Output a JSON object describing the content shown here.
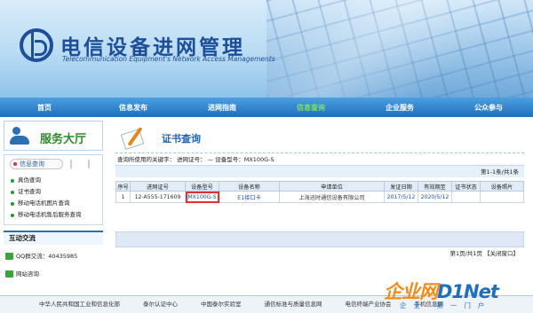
{
  "header": {
    "title_cn": "电信设备进网管理",
    "title_en": "Telecommunication Equipment's Network Access Managements"
  },
  "nav": {
    "items": [
      "首页",
      "信息发布",
      "进网指南",
      "信息查询",
      "企业服务",
      "公众参与"
    ],
    "active": "信息查询"
  },
  "sidebar": {
    "hall_title": "服务大厅",
    "query_tab": "信息查询",
    "query_items": [
      "真伪查询",
      "证书查询",
      "移动电话机图片查询",
      "移动电话机售后服务查询"
    ],
    "interact_title": "互动交流",
    "qq": "QQ群交流：40435985",
    "online": "网站咨询"
  },
  "main": {
    "section_title": "证书查询",
    "keyword_line": "查询所使用的关键字： 进网证号： — 设备型号：MX100G-S",
    "count_top": "第1-1条/共1条",
    "table": {
      "headers": [
        "序号",
        "进网证号",
        "设备型号",
        "设备名称",
        "申请单位",
        "发证日期",
        "有效期至",
        "证书状态",
        "设备照片"
      ],
      "rows": [
        [
          "1",
          "12-A555-171609",
          "MX100G-S",
          "E1接口卡",
          "上海迅时通信设备有限公司",
          "2017/5/12",
          "2020/5/12",
          "",
          ""
        ]
      ]
    },
    "pager": "第1页/共1页 【关闭窗口】"
  },
  "footer": {
    "links": [
      "中华人民共和国工业和信息化部",
      "泰尔认证中心",
      "中国泰尔实验室",
      "通信标准与质量信息网",
      "电信终端产业协会",
      "手机信息网"
    ]
  },
  "watermark": {
    "part1": "企业网",
    "part2": "D1Net",
    "sub": "企业 第一门户"
  },
  "colors": {
    "nav_active": "#7de35a",
    "brand_blue": "#1d4f98",
    "highlight_border": "#e03030"
  }
}
